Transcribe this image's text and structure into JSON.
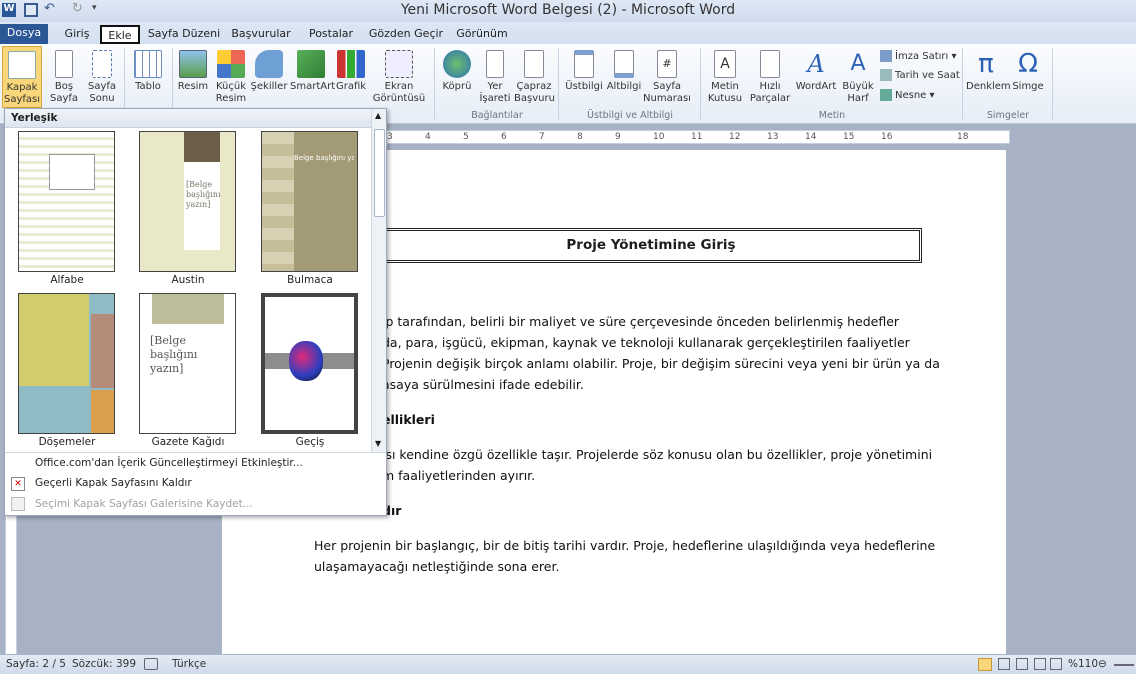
{
  "window": {
    "title": "Yeni Microsoft Word Belgesi (2)  -  Microsoft Word"
  },
  "tabs": [
    "Dosya",
    "Giriş",
    "Ekle",
    "Sayfa Düzeni",
    "Başvurular",
    "Postalar",
    "Gözden Geçir",
    "Görünüm"
  ],
  "ribbon": {
    "pages": {
      "cover": "Kapak Sayfası",
      "blank": "Boş Sayfa",
      "break": "Sayfa Sonu"
    },
    "table": "Tablo",
    "illustrations": {
      "picture": "Resim",
      "clipart": "Küçük Resim",
      "shapes": "Şekiller",
      "smartart": "SmartArt",
      "chart": "Grafik",
      "screenshot": "Ekran Görüntüsü"
    },
    "links": {
      "hyperlink": "Köprü",
      "bookmark": "Yer İşareti",
      "crossref": "Çapraz Başvuru",
      "group": "Bağlantılar"
    },
    "header_footer": {
      "header": "Üstbilgi",
      "footer": "Altbilgi",
      "page_number": "Sayfa Numarası",
      "group": "Üstbilgi ve Altbilgi"
    },
    "text": {
      "textbox": "Metin Kutusu",
      "quickparts": "Hızlı Parçalar",
      "wordart": "WordArt",
      "dropcap": "Büyük Harf",
      "signature": "İmza Satırı",
      "datetime": "Tarih ve Saat",
      "object": "Nesne",
      "group": "Metin"
    },
    "symbols": {
      "equation": "Denklem",
      "symbol": "Simge",
      "group": "Simgeler"
    }
  },
  "gallery": {
    "header": "Yerleşik",
    "items": [
      "Alfabe",
      "Austin",
      "Bulmaca",
      "Döşemeler",
      "Gazete Kağıdı",
      "Geçiş"
    ],
    "thumb_texts": {
      "austin": "[Belge başlığını yazın]",
      "bulmaca": "Belge başlığını yazın]",
      "gazete": "[Belge başlığını yazın]"
    },
    "menu": [
      "Office.com'dan İçerik Güncelleştirmeyi Etkinleştir...",
      "Geçerli Kapak Sayfasını Kaldır",
      "Seçimi Kapak Sayfası Galerisine Kaydet..."
    ]
  },
  "document": {
    "title": "Proje Yönetimine Giriş",
    "line1": "ip tarafından, belirli bir maliyet ve süre çerçevesinde önceden belirlenmiş hedefler",
    "line2": "da, para, işgücü, ekipman, kaynak ve teknoloji kullanarak gerçekleştirilen faaliyetler",
    "line3": "Projenin değişik birçok anlamı olabilir. Proje, bir değişim sürecini veya yeni bir ürün ya da",
    "line4": "asaya sürülmesini ifade edebilir.",
    "heading2": "ellikleri",
    "line5": "ısı kendine özgü özellikle taşır. Projelerde söz konusu olan bu özellikler, proje yönetimini",
    "line6": "m faaliyetlerinden ayırır.",
    "heading3": "dır",
    "line7": "Her projenin bir başlangıç, bir de bitiş tarihi vardır. Proje, hedeflerine ulaşıldığında veya hedeflerine",
    "line8": "ulaşamayacağı netleştiğinde sona erer."
  },
  "ruler": [
    "3",
    "4",
    "5",
    "6",
    "7",
    "8",
    "9",
    "10",
    "11",
    "12",
    "13",
    "14",
    "15",
    "16",
    "18"
  ],
  "status": {
    "page": "Sayfa: 2 / 5",
    "words": "Sözcük: 399",
    "language": "Türkçe",
    "zoom": "%110"
  }
}
